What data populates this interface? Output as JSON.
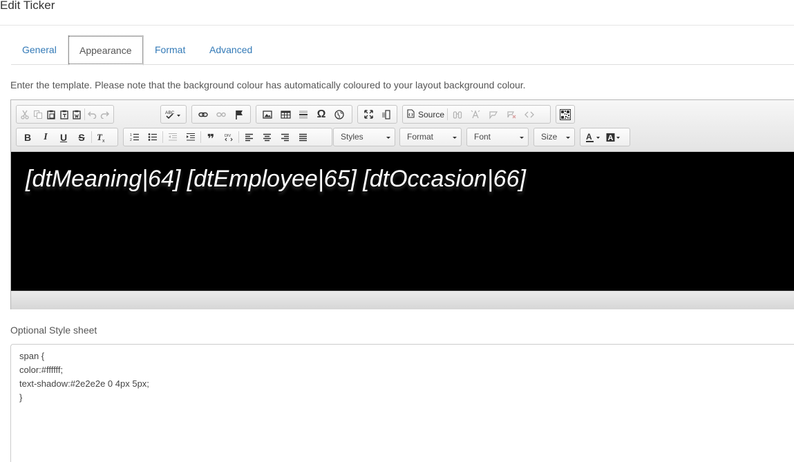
{
  "page": {
    "title": "Edit Ticker"
  },
  "tabs": [
    {
      "label": "General"
    },
    {
      "label": "Appearance",
      "active": true
    },
    {
      "label": "Format"
    },
    {
      "label": "Advanced"
    }
  ],
  "hint": "Enter the template. Please note that the background colour has automatically coloured to your layout background colour.",
  "toolbar": {
    "row1_icons": [
      "cut-icon",
      "copy-icon",
      "paste-icon",
      "paste-text-icon",
      "paste-word-icon",
      "undo-icon",
      "redo-icon",
      "spellcheck-icon",
      "link-icon",
      "unlink-icon",
      "anchor-icon",
      "image-icon",
      "table-icon",
      "horizontal-line-icon",
      "special-char-icon",
      "iframe-icon",
      "maximize-icon",
      "show-blocks-icon",
      "source-icon",
      "find-icon",
      "replace-icon",
      "comment-icon",
      "uncomment-icon",
      "code-icon",
      "qr-icon"
    ],
    "source_label": "Source",
    "glyphs": {
      "special_char": "Ω",
      "blockquote": "❞"
    },
    "combos": {
      "styles": "Styles",
      "format": "Format",
      "font": "Font",
      "size": "Size"
    }
  },
  "editor": {
    "background": "#000000",
    "text_color": "#ffffff",
    "template": "[dtMeaning|64] [dtEmployee|65] [dtOccasion|66]"
  },
  "stylesheet": {
    "label": "Optional Style sheet",
    "value": "span {\ncolor:#ffffff;\ntext-shadow:#2e2e2e 0 4px 5px;\n}"
  }
}
